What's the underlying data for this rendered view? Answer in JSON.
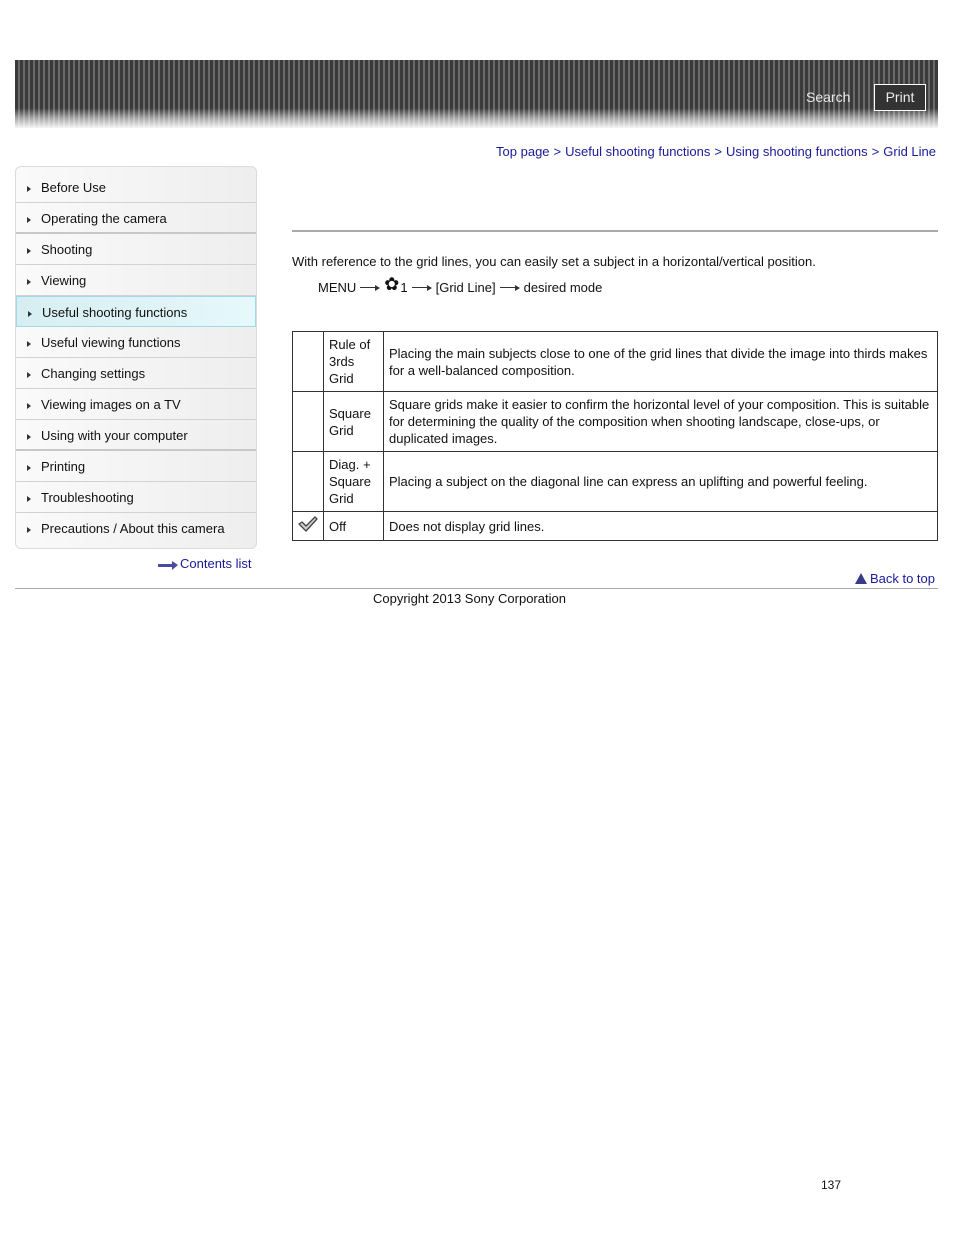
{
  "header": {
    "search_label": "Search",
    "print_label": "Print"
  },
  "breadcrumb": [
    {
      "label": "Top page"
    },
    {
      "label": "Useful shooting functions"
    },
    {
      "label": "Using shooting functions"
    },
    {
      "label": "Grid Line"
    }
  ],
  "breadcrumb_separator": ">",
  "sidebar": {
    "items": [
      {
        "label": "Before Use"
      },
      {
        "label": "Operating the camera"
      },
      {
        "label": "Shooting"
      },
      {
        "label": "Viewing"
      },
      {
        "label": "Useful shooting functions",
        "active": true
      },
      {
        "label": "Useful viewing functions"
      },
      {
        "label": "Changing settings"
      },
      {
        "label": "Viewing images on a TV"
      },
      {
        "label": "Using with your computer"
      },
      {
        "label": "Printing"
      },
      {
        "label": "Troubleshooting"
      },
      {
        "label": "Precautions / About this camera"
      }
    ],
    "contents_link": "Contents list",
    "active_color": "#d6eef2"
  },
  "main": {
    "intro": "With reference to the grid lines, you can easily set a subject in a horizontal/vertical position.",
    "menu_path": {
      "menu": "MENU",
      "settings_icon": "gear-icon",
      "settings_page": "1",
      "item": "[Grid Line]",
      "target": "desired mode"
    },
    "table": [
      {
        "icon": "",
        "name": "Rule of 3rds Grid",
        "description": "Placing the main subjects close to one of the grid lines that divide the image into thirds makes for a well-balanced composition."
      },
      {
        "icon": "",
        "name": "Square Grid",
        "description": "Square grids make it easier to confirm the horizontal level of your composition. This is suitable for determining the quality of the composition when shooting landscape, close-ups, or duplicated images."
      },
      {
        "icon": "",
        "name": "Diag. + Square Grid",
        "description": "Placing a subject on the diagonal line can express an uplifting and powerful feeling."
      },
      {
        "icon": "checkmark-icon",
        "name": "Off",
        "description": "Does not display grid lines."
      }
    ]
  },
  "footer": {
    "back_to_top": "Back to top",
    "copyright": "Copyright 2013 Sony Corporation",
    "page_number": "137"
  },
  "colors": {
    "link": "#1a1a99",
    "header_dark": "#3a3a3a"
  }
}
